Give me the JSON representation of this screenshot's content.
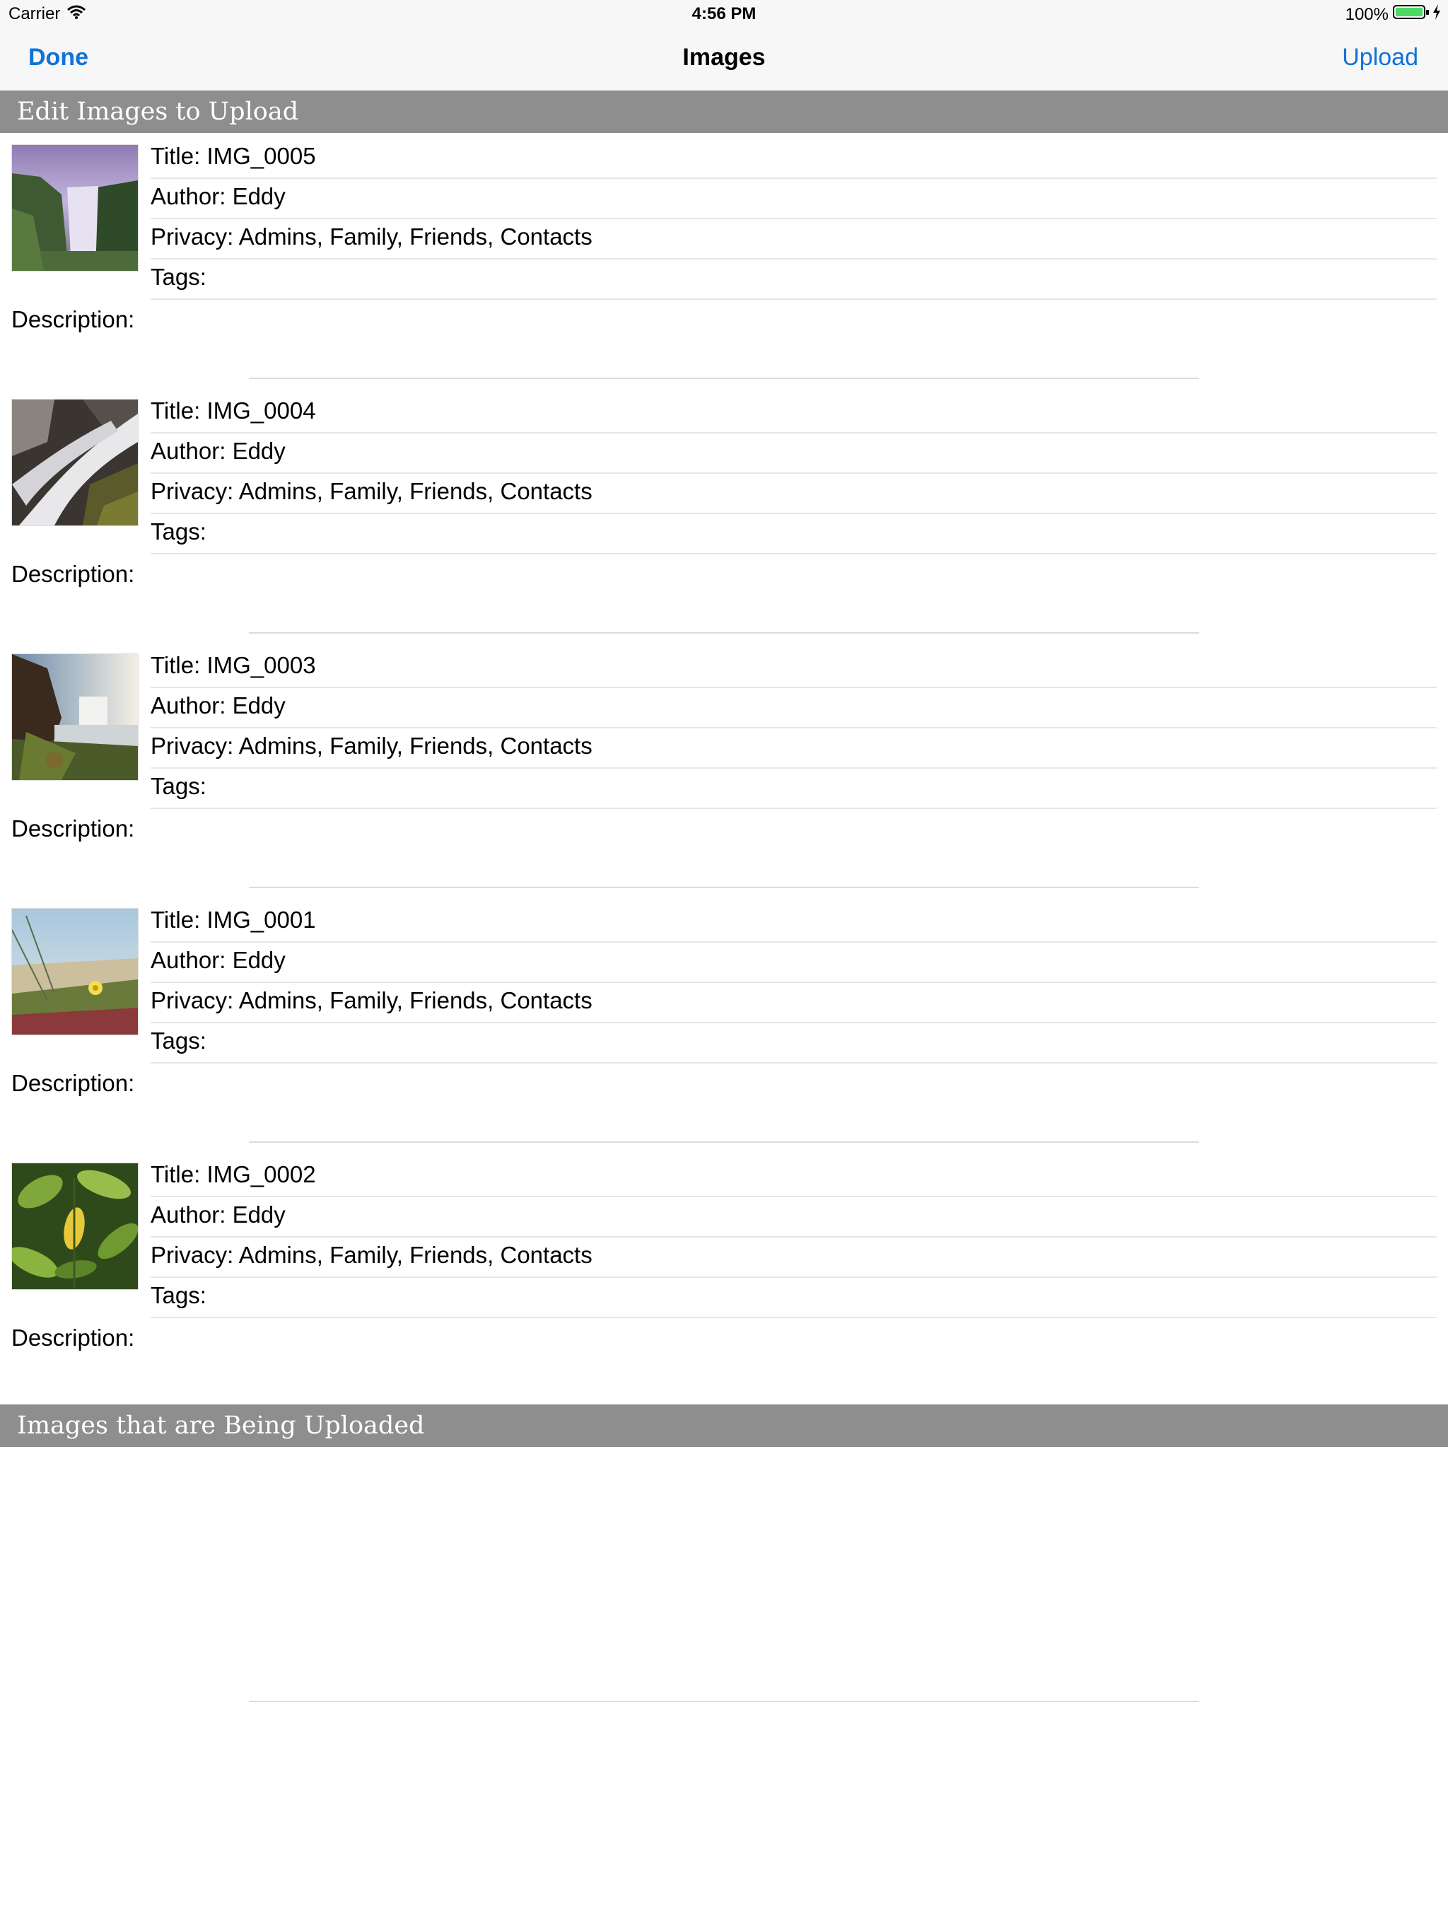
{
  "status_bar": {
    "carrier": "Carrier",
    "time": "4:56 PM",
    "battery": "100%"
  },
  "nav_bar": {
    "left_button": "Done",
    "title": "Images",
    "right_button": "Upload"
  },
  "sections": {
    "edit_header": "Edit Images to Upload",
    "uploading_header": "Images that are Being Uploaded"
  },
  "labels": {
    "description": "Description:"
  },
  "images": [
    {
      "title": "Title: IMG_0005",
      "author": "Author: Eddy",
      "privacy": "Privacy: Admins, Family, Friends, Contacts",
      "tags": "Tags:",
      "thumb": "waterfall-purple-sky"
    },
    {
      "title": "Title: IMG_0004",
      "author": "Author: Eddy",
      "privacy": "Privacy: Admins, Family, Friends, Contacts",
      "tags": "Tags:",
      "thumb": "waterfall-rocks"
    },
    {
      "title": "Title: IMG_0003",
      "author": "Author: Eddy",
      "privacy": "Privacy: Admins, Family, Friends, Contacts",
      "tags": "Tags:",
      "thumb": "waterfall-cliff"
    },
    {
      "title": "Title: IMG_0001",
      "author": "Author: Eddy",
      "privacy": "Privacy: Admins, Family, Friends, Contacts",
      "tags": "Tags:",
      "thumb": "flower-dunes"
    },
    {
      "title": "Title: IMG_0002",
      "author": "Author: Eddy",
      "privacy": "Privacy: Admins, Family, Friends, Contacts",
      "tags": "Tags:",
      "thumb": "green-leaves"
    }
  ],
  "colors": {
    "tint": "#1172d9",
    "section_header_bg": "#8e8e8e",
    "bar_bg": "#f7f7f7",
    "battery_green": "#4cd964"
  }
}
